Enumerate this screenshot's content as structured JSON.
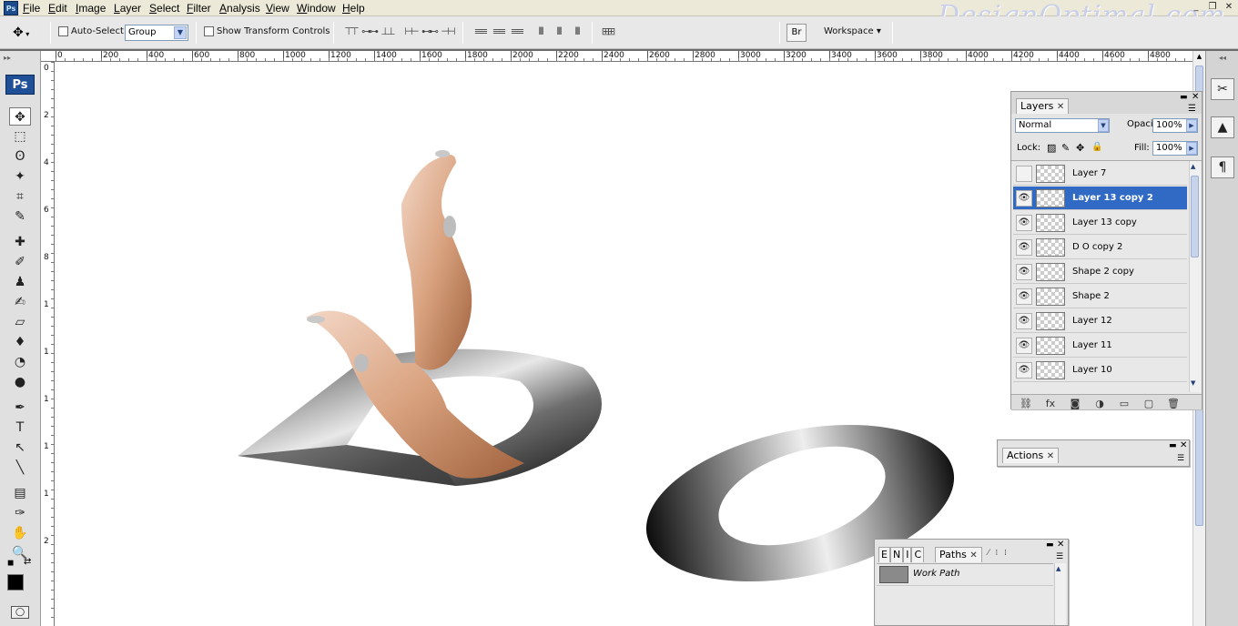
{
  "app": {
    "logo": "Ps",
    "mini_logo": "Ps",
    "watermark": "DesignOptimal.com"
  },
  "menu": [
    "File",
    "Edit",
    "Image",
    "Layer",
    "Select",
    "Filter",
    "Analysis",
    "View",
    "Window",
    "Help"
  ],
  "window_controls": {
    "minimize": "_",
    "restore": "❐",
    "close": "✕"
  },
  "options": {
    "auto_select_label": "Auto-Select:",
    "auto_select_value": "Group",
    "transform_label": "Show Transform Controls",
    "workspace_label": "Workspace ▾"
  },
  "ruler_top": [
    "0",
    "200",
    "400",
    "600",
    "800",
    "1000",
    "1200",
    "1400",
    "1600",
    "1800",
    "2000",
    "2200",
    "2400",
    "2600",
    "2800",
    "3000",
    "3200",
    "3400",
    "3600",
    "3800",
    "4000",
    "4200",
    "4400",
    "4600",
    "4800"
  ],
  "ruler_left": [
    "0",
    "2",
    "4",
    "6",
    "8",
    "1",
    "1",
    "1",
    "1",
    "1",
    "2"
  ],
  "layers_panel": {
    "tab": "Layers",
    "blend_mode": "Normal",
    "opacity_label": "Opacity:",
    "opacity_value": "100%",
    "lock_label": "Lock:",
    "fill_label": "Fill:",
    "fill_value": "100%",
    "layers": [
      {
        "name": "Layer 7",
        "visible": false,
        "selected": false
      },
      {
        "name": "Layer 13 copy 2",
        "visible": true,
        "selected": true
      },
      {
        "name": "Layer 13 copy",
        "visible": true,
        "selected": false
      },
      {
        "name": "D O copy 2",
        "visible": true,
        "selected": false
      },
      {
        "name": "Shape 2 copy",
        "visible": true,
        "selected": false
      },
      {
        "name": "Shape 2",
        "visible": true,
        "selected": false
      },
      {
        "name": "Layer 12",
        "visible": true,
        "selected": false
      },
      {
        "name": "Layer 11",
        "visible": true,
        "selected": false
      },
      {
        "name": "Layer 10",
        "visible": true,
        "selected": false
      }
    ],
    "bottom_icons": [
      "link-icon",
      "fx-icon",
      "mask-icon",
      "adjustment-icon",
      "group-icon",
      "new-layer-icon",
      "trash-icon"
    ],
    "bottom_glyphs": [
      "⛓",
      "fx",
      "◙",
      "◑",
      "▭",
      "▢",
      "🗑"
    ]
  },
  "actions_panel": {
    "tab": "Actions"
  },
  "paths_panel": {
    "tab": "Paths",
    "side_tabs": [
      "E",
      "N",
      "I",
      "C"
    ],
    "work_path": "Work Path"
  },
  "tools": [
    {
      "name": "move-tool-icon",
      "glyph": "✥"
    },
    {
      "name": "marquee-tool-icon",
      "glyph": "⬚"
    },
    {
      "name": "lasso-tool-icon",
      "glyph": "ʘ"
    },
    {
      "name": "magic-wand-icon",
      "glyph": "✦"
    },
    {
      "name": "crop-tool-icon",
      "glyph": "⌗"
    },
    {
      "name": "eyedropper-icon",
      "glyph": "✎"
    },
    {
      "name": "healing-brush-icon",
      "glyph": "✚"
    },
    {
      "name": "brush-tool-icon",
      "glyph": "✐"
    },
    {
      "name": "stamp-tool-icon",
      "glyph": "♟"
    },
    {
      "name": "history-brush-icon",
      "glyph": "✍"
    },
    {
      "name": "eraser-tool-icon",
      "glyph": "▱"
    },
    {
      "name": "paint-bucket-icon",
      "glyph": "♦"
    },
    {
      "name": "dodge-tool-icon",
      "glyph": "◔"
    },
    {
      "name": "sponge-tool-icon",
      "glyph": "●"
    },
    {
      "name": "pen-tool-icon",
      "glyph": "✒"
    },
    {
      "name": "type-tool-icon",
      "glyph": "T"
    },
    {
      "name": "path-select-icon",
      "glyph": "↖"
    },
    {
      "name": "line-tool-icon",
      "glyph": "╲"
    },
    {
      "name": "notes-tool-icon",
      "glyph": "▤"
    },
    {
      "name": "eyedropper-2-icon",
      "glyph": "✑"
    },
    {
      "name": "hand-tool-icon",
      "glyph": "✋"
    },
    {
      "name": "zoom-tool-icon",
      "glyph": "🔍"
    }
  ],
  "colors": {
    "selection": "#316ac5",
    "workspace": "#e0e0e0",
    "logo": "#1f4f96"
  }
}
